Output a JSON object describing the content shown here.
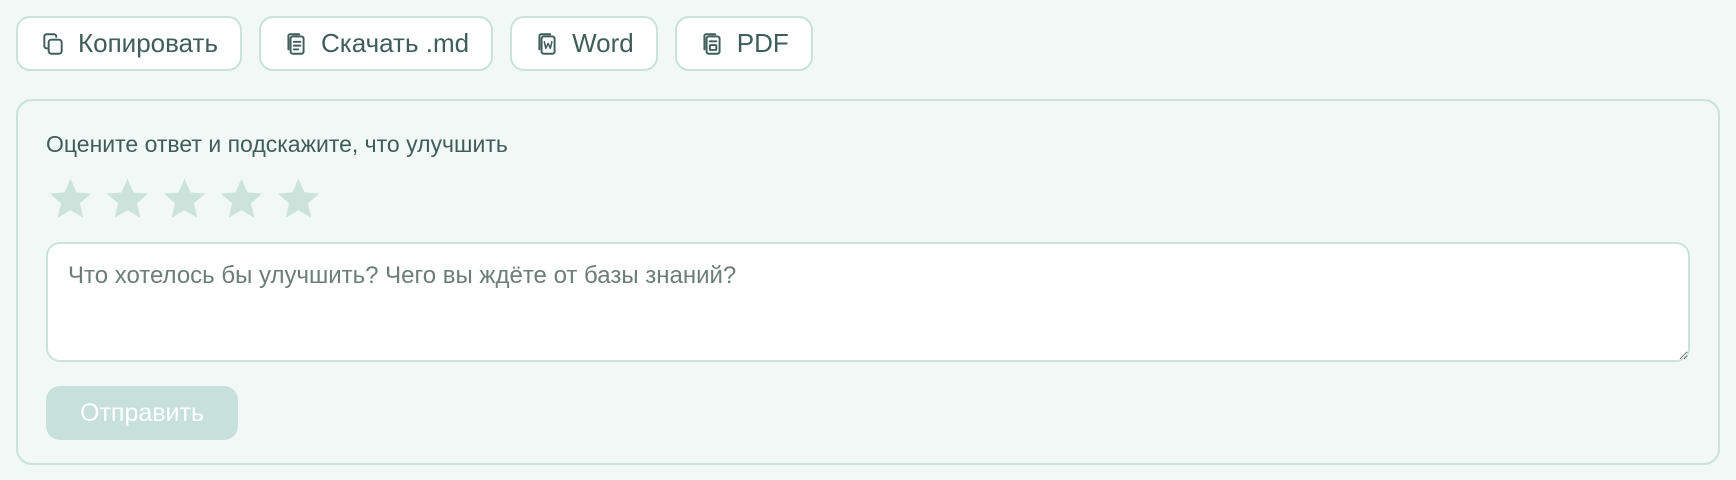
{
  "toolbar": {
    "buttons": [
      {
        "label": "Копировать",
        "icon": "copy-icon"
      },
      {
        "label": "Скачать .md",
        "icon": "markdown-file-icon"
      },
      {
        "label": "Word",
        "icon": "word-file-icon"
      },
      {
        "label": "PDF",
        "icon": "pdf-file-icon"
      }
    ]
  },
  "feedback": {
    "title": "Оцените ответ и подскажите, что улучшить",
    "rating": {
      "value": 0,
      "max": 5
    },
    "comment": {
      "value": "",
      "placeholder": "Что хотелось бы улучшить? Чего вы ждёте от базы знаний?"
    },
    "submit_label": "Отправить"
  },
  "colors": {
    "background": "#f1f8f5",
    "border": "#c9e2db",
    "star_inactive": "#cce3dc",
    "submit_disabled": "#c7e1da",
    "text": "#3f5e58"
  }
}
